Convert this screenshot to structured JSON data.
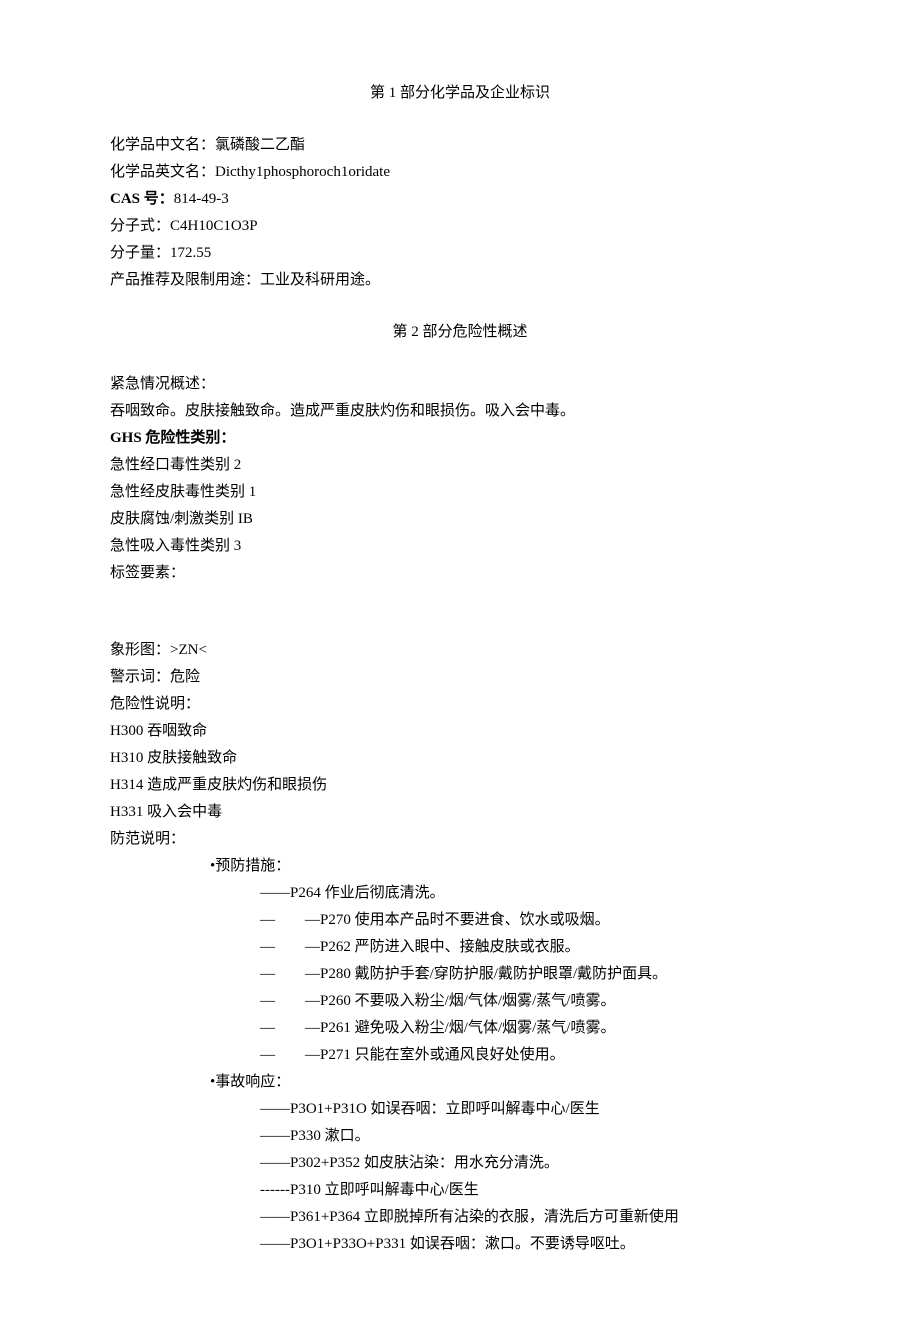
{
  "section1": {
    "title": "第 1 部分化学品及企业标识",
    "fields": {
      "chinese_name_label": "化学品中文名：",
      "chinese_name_value": "氯磷酸二乙酯",
      "english_name_label": "化学品英文名：",
      "english_name_value": "Dicthy1phosphoroch1oridate",
      "cas_label": "CAS 号：",
      "cas_value": "814-49-3",
      "formula_label": "分子式：",
      "formula_value": "C4H10C1O3P",
      "weight_label": "分子量：",
      "weight_value": "172.55",
      "usage_label": "产品推荐及限制用途：",
      "usage_value": "工业及科研用途。"
    }
  },
  "section2": {
    "title": "第 2 部分危险性概述",
    "emergency_label": "紧急情况概述：",
    "emergency_value": "吞咽致命。皮肤接触致命。造成严重皮肤灼伤和眼损伤。吸入会中毒。",
    "ghs_label": "GHS 危险性类别：",
    "ghs_items": [
      "急性经口毒性类别 2",
      "急性经皮肤毒性类别 1",
      "皮肤腐蚀/刺激类别 IB",
      "急性吸入毒性类别 3"
    ],
    "label_elements": "标签要素：",
    "pictogram_label": "象形图：",
    "pictogram_value": ">ZN<",
    "signal_word_label": "警示词：",
    "signal_word_value": "危险",
    "hazard_label": "危险性说明：",
    "hazard_items": [
      "H300 吞咽致命",
      "H310 皮肤接触致命",
      "H314 造成严重皮肤灼伤和眼损伤",
      "H331 吸入会中毒"
    ],
    "precaution_label": "防范说明：",
    "prevention_label": "•预防措施：",
    "prevention_items": [
      {
        "dash": "——",
        "text": "P264 作业后彻底清洗。"
      },
      {
        "dash": "—　　—",
        "text": "P270 使用本产品时不要进食、饮水或吸烟。"
      },
      {
        "dash": "—　　—",
        "text": "P262 严防进入眼中、接触皮肤或衣服。"
      },
      {
        "dash": "—　　—",
        "text": "P280 戴防护手套/穿防护服/戴防护眼罩/戴防护面具。"
      },
      {
        "dash": "—　　—",
        "text": "P260 不要吸入粉尘/烟/气体/烟雾/蒸气/喷雾。"
      },
      {
        "dash": "—　　—",
        "text": "P261 避免吸入粉尘/烟/气体/烟雾/蒸气/喷雾。"
      },
      {
        "dash": "—　　—",
        "text": "P271 只能在室外或通风良好处使用。"
      }
    ],
    "response_label": "•事故响应：",
    "response_items": [
      {
        "dash": "——",
        "text": "P3O1+P31O 如误吞咽：立即呼叫解毒中心/医生"
      },
      {
        "dash": "——",
        "text": "P330 漱口。"
      },
      {
        "dash": "——",
        "text": "P302+P352 如皮肤沾染：用水充分清洗。"
      },
      {
        "dash": "------",
        "text": "P310 立即呼叫解毒中心/医生"
      },
      {
        "dash": "——",
        "text": "P361+P364 立即脱掉所有沾染的衣服，清洗后方可重新使用"
      },
      {
        "dash": "——",
        "text": "P3O1+P33O+P331 如误吞咽：漱口。不要诱导呕吐。"
      }
    ]
  }
}
